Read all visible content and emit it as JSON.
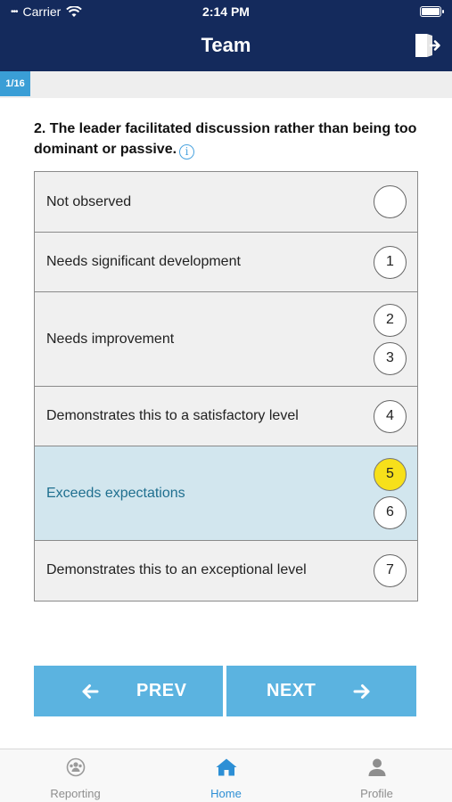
{
  "status_bar": {
    "carrier": "Carrier",
    "time": "2:14 PM"
  },
  "header": {
    "title": "Team"
  },
  "progress": {
    "label": "1/16",
    "current": 1,
    "total": 16
  },
  "question": {
    "text": "2.  The leader facilitated discussion rather than being too dominant or passive.",
    "info_symbol": "i"
  },
  "options": [
    {
      "label": "Not observed",
      "scores": [
        ""
      ],
      "selected": false
    },
    {
      "label": "Needs significant development",
      "scores": [
        "1"
      ],
      "selected": false
    },
    {
      "label": "Needs improvement",
      "scores": [
        "2",
        "3"
      ],
      "selected": false
    },
    {
      "label": "Demonstrates this to a satisfactory level",
      "scores": [
        "4"
      ],
      "selected": false
    },
    {
      "label": "Exceeds expectations",
      "scores": [
        "5",
        "6"
      ],
      "selected": true,
      "selected_score": "5"
    },
    {
      "label": "Demonstrates this to an exceptional level",
      "scores": [
        "7"
      ],
      "selected": false
    }
  ],
  "buttons": {
    "prev": "PREV",
    "next": "NEXT"
  },
  "tabs": [
    {
      "label": "Reporting",
      "icon": "reporting-icon",
      "active": false
    },
    {
      "label": "Home",
      "icon": "home-icon",
      "active": true
    },
    {
      "label": "Profile",
      "icon": "profile-icon",
      "active": false
    }
  ],
  "colors": {
    "header": "#142a5c",
    "accent": "#5bb3e0",
    "selected_row": "#d2e6ee",
    "selected_score": "#f7e01a",
    "active_tab": "#2d8fd5"
  }
}
